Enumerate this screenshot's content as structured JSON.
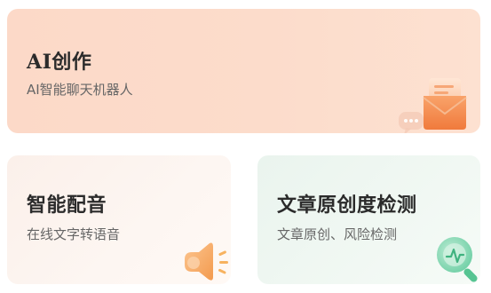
{
  "cards": {
    "ai_writing": {
      "title": "AI创作",
      "subtitle": "AI智能聊天机器人",
      "icon": "envelope-chat-icon",
      "color": "#fcd9c8"
    },
    "voice": {
      "title": "智能配音",
      "subtitle": "在线文字转语音",
      "icon": "speaker-icon",
      "color": "#fbf0ea"
    },
    "originality": {
      "title": "文章原创度检测",
      "subtitle": "文章原创、风险检测",
      "icon": "magnifier-icon",
      "color": "#eaf4ee"
    }
  }
}
